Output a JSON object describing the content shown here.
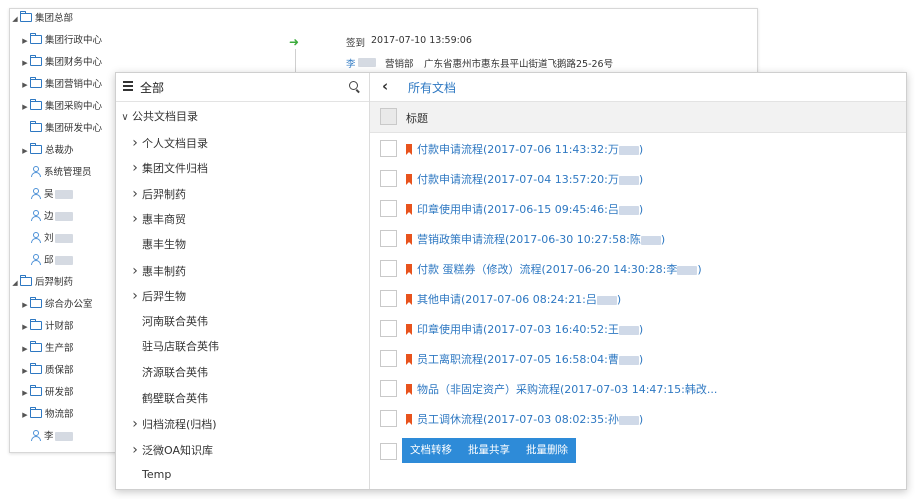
{
  "bg": {
    "tree": [
      {
        "label": "集团总部",
        "type": "folder",
        "level": 0,
        "expanded": true
      },
      {
        "label": "集团行政中心",
        "type": "folder",
        "level": 1,
        "expanded": false
      },
      {
        "label": "集团财务中心",
        "type": "folder",
        "level": 1,
        "expanded": false
      },
      {
        "label": "集团营销中心",
        "type": "folder",
        "level": 1,
        "expanded": false
      },
      {
        "label": "集团采购中心",
        "type": "folder",
        "level": 1,
        "expanded": false
      },
      {
        "label": "集团研发中心",
        "type": "folder",
        "level": 1,
        "leaf": true
      },
      {
        "label": "总裁办",
        "type": "folder",
        "level": 1,
        "expanded": false
      },
      {
        "label": "系统管理员",
        "type": "user",
        "level": 1
      },
      {
        "label": "吴",
        "type": "user",
        "level": 1,
        "blurred": true
      },
      {
        "label": "边",
        "type": "user",
        "level": 1,
        "blurred": true
      },
      {
        "label": "刘",
        "type": "user",
        "level": 1,
        "blurred": true
      },
      {
        "label": "邱",
        "type": "user",
        "level": 1,
        "blurred": true
      },
      {
        "label": "后羿制药",
        "type": "folder",
        "level": 0,
        "expanded": true
      },
      {
        "label": "综合办公室",
        "type": "folder",
        "level": 1,
        "expanded": false
      },
      {
        "label": "计财部",
        "type": "folder",
        "level": 1,
        "expanded": false
      },
      {
        "label": "生产部",
        "type": "folder",
        "level": 1,
        "expanded": false
      },
      {
        "label": "质保部",
        "type": "folder",
        "level": 1,
        "expanded": false
      },
      {
        "label": "研发部",
        "type": "folder",
        "level": 1,
        "expanded": false
      },
      {
        "label": "物流部",
        "type": "folder",
        "level": 1,
        "expanded": false
      },
      {
        "label": "李",
        "type": "user",
        "level": 1,
        "blurred": true
      }
    ],
    "signin_label": "签到",
    "signin_time": "2017-07-10 13:59:06",
    "user_name": "李",
    "dept": "营销部",
    "address": "广东省惠州市惠东县平山街道飞鹅路25-26号"
  },
  "panel": {
    "left_title": "全部",
    "folders": [
      {
        "label": "公共文档目录",
        "level": 0,
        "chevron": "down"
      },
      {
        "label": "个人文档目录",
        "level": 1,
        "chevron": "right"
      },
      {
        "label": "集团文件归档",
        "level": 1,
        "chevron": "right"
      },
      {
        "label": "后羿制药",
        "level": 1,
        "chevron": "right"
      },
      {
        "label": "惠丰商贸",
        "level": 1,
        "chevron": "right"
      },
      {
        "label": "惠丰生物",
        "level": 1,
        "chevron": ""
      },
      {
        "label": "惠丰制药",
        "level": 1,
        "chevron": "right"
      },
      {
        "label": "后羿生物",
        "level": 1,
        "chevron": "right"
      },
      {
        "label": "河南联合英伟",
        "level": 1,
        "chevron": ""
      },
      {
        "label": "驻马店联合英伟",
        "level": 1,
        "chevron": ""
      },
      {
        "label": "济源联合英伟",
        "level": 1,
        "chevron": ""
      },
      {
        "label": "鹤壁联合英伟",
        "level": 1,
        "chevron": ""
      },
      {
        "label": "归档流程(归档)",
        "level": 1,
        "chevron": "right"
      },
      {
        "label": "泛微OA知识库",
        "level": 1,
        "chevron": "right"
      },
      {
        "label": "Temp",
        "level": 1,
        "chevron": ""
      }
    ],
    "right_title": "所有文档",
    "column_title": "标题",
    "documents": [
      {
        "title": "付款申请流程(2017-07-06 11:43:32:万",
        "blur": true
      },
      {
        "title": "付款申请流程(2017-07-04 13:57:20:万",
        "blur": true
      },
      {
        "title": "印章使用申请(2017-06-15 09:45:46:吕",
        "blur": true
      },
      {
        "title": "营销政策申请流程(2017-06-30 10:27:58:陈",
        "blur": true
      },
      {
        "title": "付款 蛋糕券（修改）流程(2017-06-20 14:30:28:李",
        "blur": true
      },
      {
        "title": "其他申请(2017-07-06 08:24:21:吕",
        "blur": true
      },
      {
        "title": "印章使用申请(2017-07-03 16:40:52:王",
        "blur": true
      },
      {
        "title": "员工离职流程(2017-07-05 16:58:04:曹",
        "blur": true
      },
      {
        "title": "物品（非固定资产）采购流程(2017-07-03 14:47:15:韩改...",
        "blur": false
      },
      {
        "title": "员工调休流程(2017-07-03 08:02:35:孙",
        "blur": true
      }
    ],
    "actions": [
      "文档转移",
      "批量共享",
      "批量删除"
    ]
  }
}
